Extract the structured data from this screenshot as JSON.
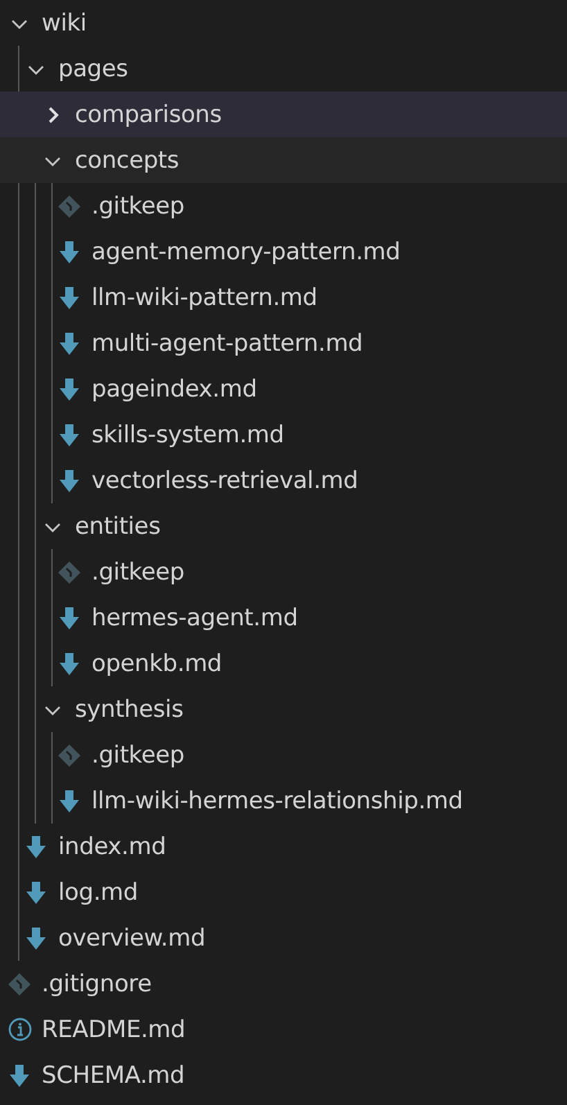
{
  "tree": [
    {
      "name": "wiki",
      "kind": "folder",
      "expanded": true,
      "children": [
        {
          "name": "pages",
          "kind": "folder",
          "expanded": true,
          "children": [
            {
              "name": "comparisons",
              "kind": "folder",
              "expanded": false,
              "selected": true
            },
            {
              "name": "concepts",
              "kind": "folder",
              "expanded": true,
              "hovered": true,
              "children": [
                {
                  "name": ".gitkeep",
                  "kind": "git"
                },
                {
                  "name": "agent-memory-pattern.md",
                  "kind": "markdown"
                },
                {
                  "name": "llm-wiki-pattern.md",
                  "kind": "markdown"
                },
                {
                  "name": "multi-agent-pattern.md",
                  "kind": "markdown"
                },
                {
                  "name": "pageindex.md",
                  "kind": "markdown"
                },
                {
                  "name": "skills-system.md",
                  "kind": "markdown"
                },
                {
                  "name": "vectorless-retrieval.md",
                  "kind": "markdown"
                }
              ]
            },
            {
              "name": "entities",
              "kind": "folder",
              "expanded": true,
              "children": [
                {
                  "name": ".gitkeep",
                  "kind": "git"
                },
                {
                  "name": "hermes-agent.md",
                  "kind": "markdown"
                },
                {
                  "name": "openkb.md",
                  "kind": "markdown"
                }
              ]
            },
            {
              "name": "synthesis",
              "kind": "folder",
              "expanded": true,
              "children": [
                {
                  "name": ".gitkeep",
                  "kind": "git"
                },
                {
                  "name": "llm-wiki-hermes-relationship.md",
                  "kind": "markdown"
                }
              ]
            }
          ]
        },
        {
          "name": "index.md",
          "kind": "markdown"
        },
        {
          "name": "log.md",
          "kind": "markdown"
        },
        {
          "name": "overview.md",
          "kind": "markdown"
        }
      ]
    },
    {
      "name": ".gitignore",
      "kind": "git"
    },
    {
      "name": "README.md",
      "kind": "info"
    },
    {
      "name": "SCHEMA.md",
      "kind": "markdown"
    }
  ]
}
